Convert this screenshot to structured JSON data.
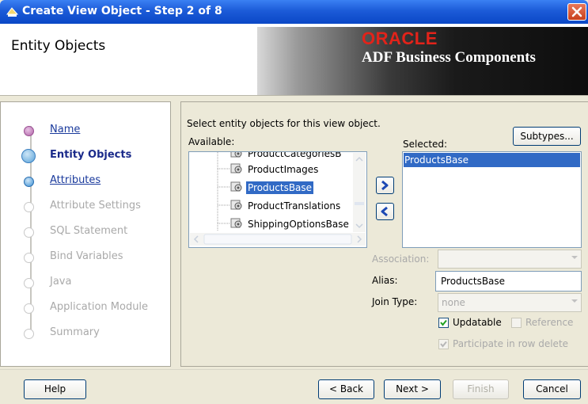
{
  "window": {
    "title": "Create View Object - Step 2 of 8",
    "icon": "jdeveloper-wizard-icon"
  },
  "header": {
    "title": "Entity Objects",
    "brand_oracle": "ORACLE",
    "brand_product": "ADF Business Components"
  },
  "nav": {
    "steps": [
      {
        "label": "Name",
        "state": "visited"
      },
      {
        "label": "Entity Objects",
        "state": "current"
      },
      {
        "label": "Attributes",
        "state": "next"
      },
      {
        "label": "Attribute Settings",
        "state": "disabled"
      },
      {
        "label": "SQL Statement",
        "state": "disabled"
      },
      {
        "label": "Bind Variables",
        "state": "disabled"
      },
      {
        "label": "Java",
        "state": "disabled"
      },
      {
        "label": "Application Module",
        "state": "disabled"
      },
      {
        "label": "Summary",
        "state": "disabled"
      }
    ]
  },
  "main": {
    "instruction": "Select entity objects for this view object.",
    "available_label": "Available:",
    "selected_label": "Selected:",
    "subtypes_button": "Subtypes...",
    "available_items": [
      {
        "label": "ProductCategoriesB",
        "selected": false
      },
      {
        "label": "ProductImages",
        "selected": false
      },
      {
        "label": "ProductsBase",
        "selected": true
      },
      {
        "label": "ProductTranslations",
        "selected": false
      },
      {
        "label": "ShippingOptionsBase",
        "selected": false
      }
    ],
    "selected_items": [
      "ProductsBase"
    ],
    "association_label": "Association:",
    "association_value": "",
    "alias_label": "Alias:",
    "alias_value": "ProductsBase",
    "join_type_label": "Join Type:",
    "join_type_value": "none",
    "updatable_label": "Updatable",
    "updatable_checked": true,
    "reference_label": "Reference",
    "reference_checked": false,
    "participate_label": "Participate in row delete",
    "participate_checked": true
  },
  "footer": {
    "help": "Help",
    "back": "< Back",
    "next": "Next >",
    "finish": "Finish",
    "cancel": "Cancel"
  }
}
